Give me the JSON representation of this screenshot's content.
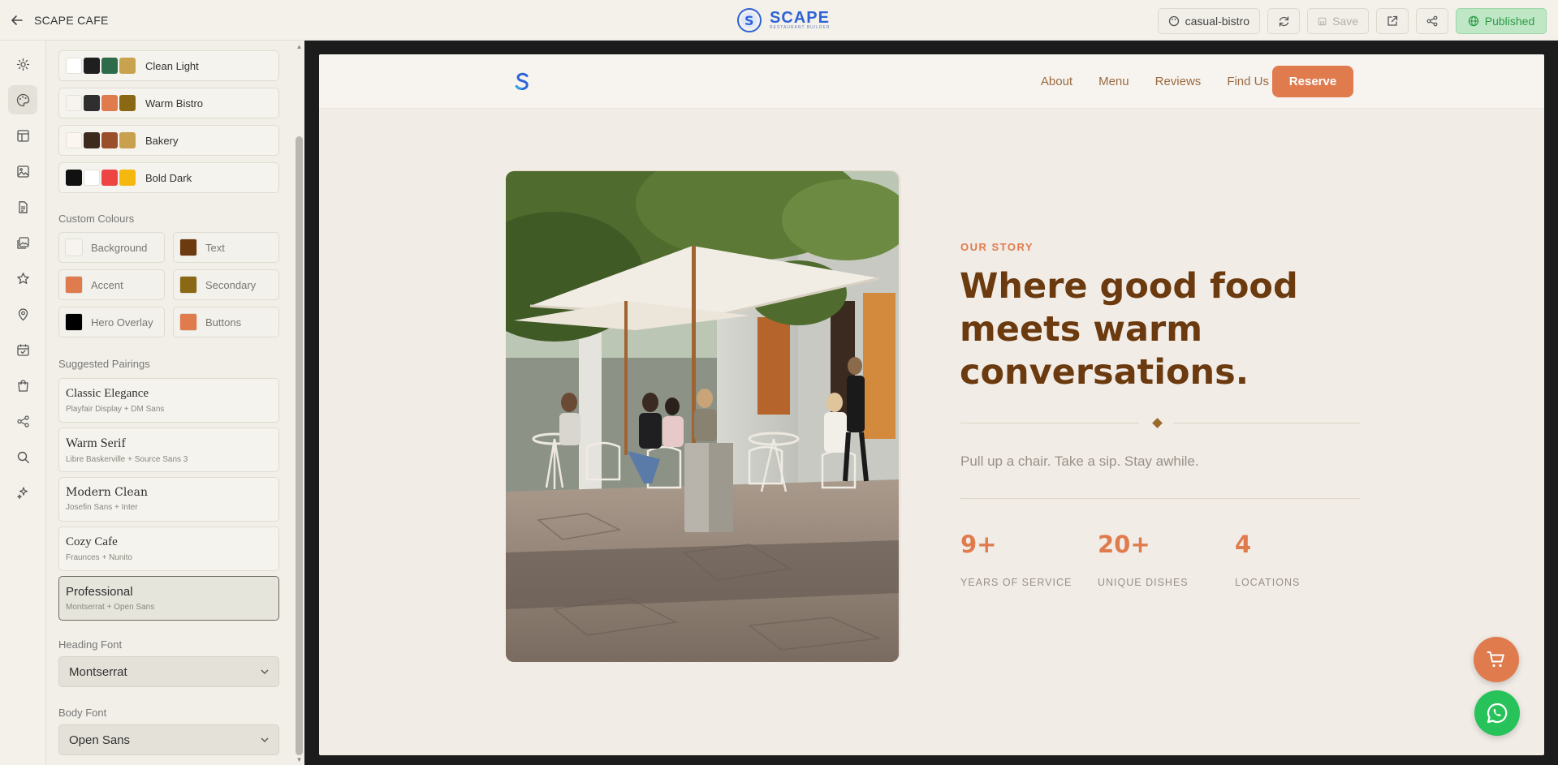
{
  "app": {
    "title": "SCAPE CAFE",
    "logo_text": "SCAPE",
    "logo_subtext": "RESTAURANT BUILDER"
  },
  "toolbar": {
    "theme_label": "casual-bistro",
    "save_label": "Save",
    "published_label": "Published"
  },
  "rail": {
    "items": [
      "gear-icon",
      "palette-icon",
      "layout-icon",
      "image-icon",
      "document-icon",
      "gallery-icon",
      "star-icon",
      "location-icon",
      "calendar-icon",
      "bag-icon",
      "share-icon",
      "search-icon",
      "sparkle-icon"
    ],
    "active": "palette-icon"
  },
  "sidebar": {
    "themes": [
      {
        "label": "Clean Light",
        "colors": [
          "#ffffff",
          "#1f1f1f",
          "#2e6b4a",
          "#c8a24e"
        ]
      },
      {
        "label": "Warm Bistro",
        "colors": [
          "#f7f4ef",
          "#2f2f2f",
          "#e07b4e",
          "#8b6914"
        ]
      },
      {
        "label": "Bakery",
        "colors": [
          "#fbf7f0",
          "#3d2a1e",
          "#9a4f2a",
          "#c9a04e"
        ]
      },
      {
        "label": "Bold Dark",
        "colors": [
          "#111111",
          "#ffffff",
          "#ef4444",
          "#f5b80f"
        ]
      }
    ],
    "custom_colours_title": "Custom Colours",
    "custom_colours": [
      {
        "label": "Background",
        "color": "#f7f4ef"
      },
      {
        "label": "Text",
        "color": "#6b3a0f"
      },
      {
        "label": "Accent",
        "color": "#e07b4e"
      },
      {
        "label": "Secondary",
        "color": "#8b6914"
      },
      {
        "label": "Hero Overlay",
        "color": "#000000"
      },
      {
        "label": "Buttons",
        "color": "#e07b4e"
      }
    ],
    "pairings_title": "Suggested Pairings",
    "pairings": [
      {
        "name": "Classic Elegance",
        "fonts": "Playfair Display + DM Sans"
      },
      {
        "name": "Warm Serif",
        "fonts": "Libre Baskerville + Source Sans 3"
      },
      {
        "name": "Modern Clean",
        "fonts": "Josefin Sans + Inter"
      },
      {
        "name": "Cozy Cafe",
        "fonts": "Fraunces + Nunito"
      },
      {
        "name": "Professional",
        "fonts": "Montserrat + Open Sans"
      }
    ],
    "heading_font_label": "Heading Font",
    "heading_font_value": "Montserrat",
    "body_font_label": "Body Font",
    "body_font_value": "Open Sans"
  },
  "site": {
    "nav": [
      "About",
      "Menu",
      "Reviews",
      "Find Us"
    ],
    "reserve_label": "Reserve",
    "eyebrow": "OUR STORY",
    "headline_lines": [
      "Where good food",
      "meets warm",
      "conversations."
    ],
    "tagline": "Pull up a chair. Take a sip. Stay awhile.",
    "stats": [
      {
        "value": "9+",
        "label": "YEARS OF SERVICE"
      },
      {
        "value": "20+",
        "label": "UNIQUE DISHES"
      },
      {
        "value": "4",
        "label": "LOCATIONS"
      }
    ]
  }
}
